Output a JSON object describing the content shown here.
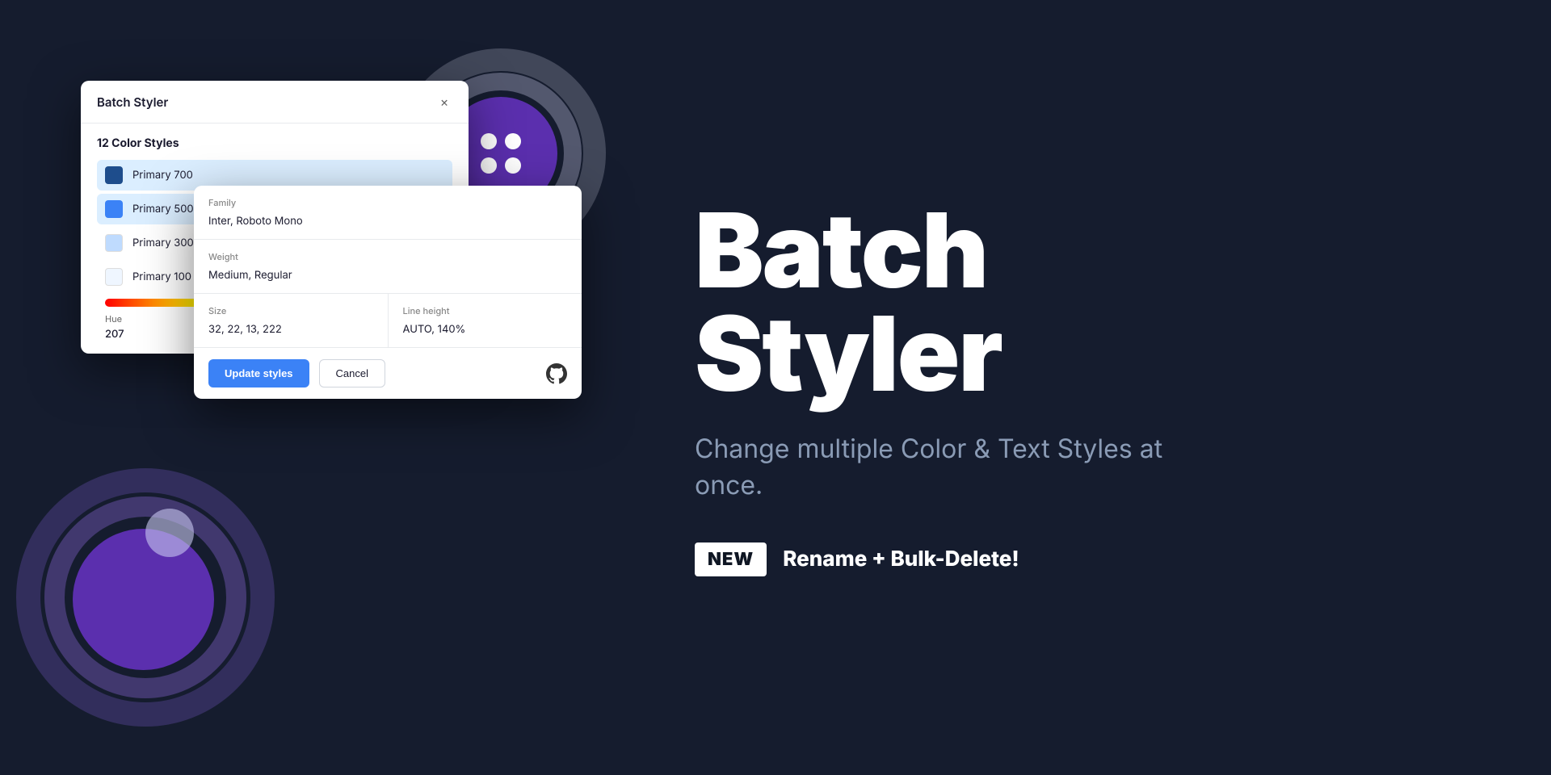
{
  "app": {
    "title": "Batch Styler",
    "hero_title_line1": "Batch",
    "hero_title_line2": "Styler",
    "hero_subtitle": "Change multiple Color & Text Styles at once.",
    "new_badge": "NEW",
    "new_feature": "Rename + Bulk-Delete!"
  },
  "plugin": {
    "title": "Batch Styler",
    "close_label": "×",
    "styles_count": "12 Color Styles",
    "colors": [
      {
        "name": "Primary 700",
        "swatch": "#1e4d8c",
        "selected": true
      },
      {
        "name": "Primary 500",
        "swatch": "#3b82f6",
        "selected": true
      },
      {
        "name": "Primary 300",
        "swatch": "#bfdbfe",
        "selected": false
      },
      {
        "name": "Primary 100",
        "swatch": "#eff6ff",
        "selected": false
      }
    ],
    "hue_label": "Hue",
    "hue_value": "207"
  },
  "typography": {
    "family_label": "Family",
    "family_value": "Inter, Roboto Mono",
    "weight_label": "Weight",
    "weight_value": "Medium, Regular",
    "size_label": "Size",
    "size_value": "32, 22, 13, 222",
    "line_height_label": "Line height",
    "line_height_value": "AUTO, 140%",
    "update_button": "Update styles",
    "cancel_button": "Cancel"
  }
}
